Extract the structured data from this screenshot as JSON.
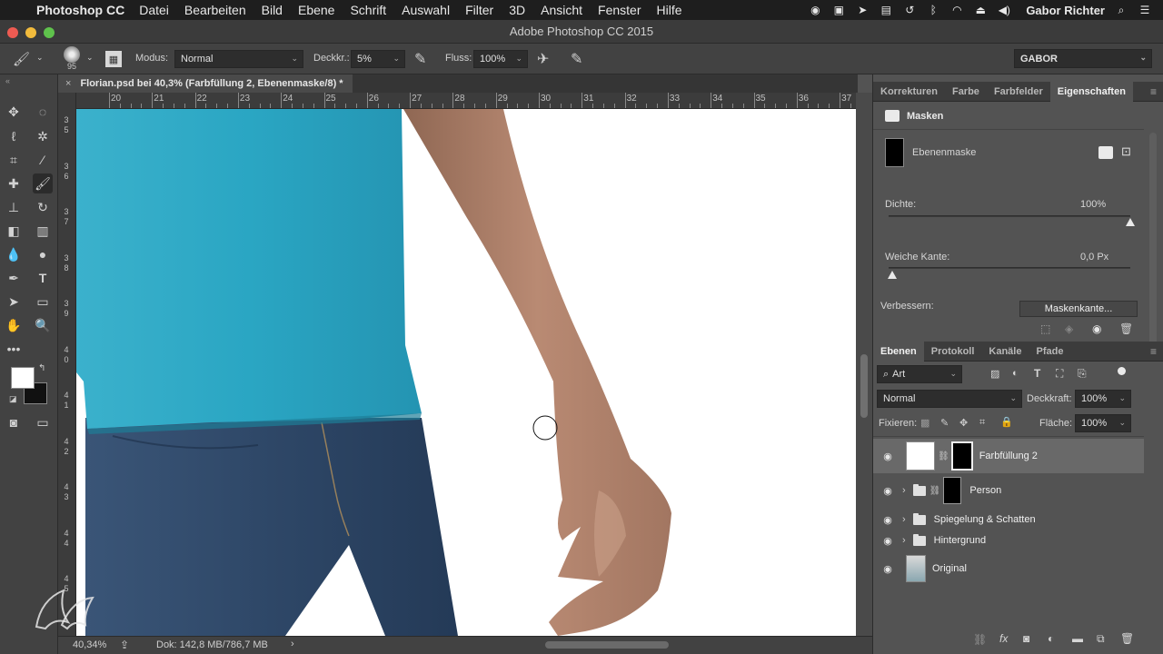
{
  "menubar": {
    "app_name": "Photoshop CC",
    "menus": [
      "Datei",
      "Bearbeiten",
      "Bild",
      "Ebene",
      "Schrift",
      "Auswahl",
      "Filter",
      "3D",
      "Ansicht",
      "Fenster",
      "Hilfe"
    ],
    "user_name": "Gabor Richter"
  },
  "window": {
    "title": "Adobe Photoshop CC 2015"
  },
  "options_bar": {
    "brush_size": "95",
    "modus_label": "Modus:",
    "modus_value": "Normal",
    "deckkraft_label": "Deckkr.:",
    "deckkraft_value": "5%",
    "fluss_label": "Fluss:",
    "fluss_value": "100%",
    "workspace": "GABOR"
  },
  "document": {
    "tab_title": "Florian.psd bei 40,3% (Farbfüllung 2, Ebenenmaske/8) *",
    "ruler_h": [
      "20",
      "21",
      "22",
      "23",
      "24",
      "25",
      "26",
      "27",
      "28",
      "29",
      "30",
      "31",
      "32",
      "33",
      "34",
      "35",
      "36",
      "37"
    ],
    "ruler_v": [
      "3",
      "5",
      "3",
      "6",
      "3",
      "7",
      "3",
      "8",
      "3",
      "9",
      "4",
      "0",
      "4",
      "1",
      "4",
      "2",
      "4",
      "3",
      "4",
      "4",
      "4",
      "5"
    ]
  },
  "status_bar": {
    "zoom": "40,34%",
    "doc_info": "Dok: 142,8 MB/786,7 MB"
  },
  "properties_panel": {
    "tabs": [
      "Korrekturen",
      "Farbe",
      "Farbfelder",
      "Eigenschaften"
    ],
    "active_tab": "Eigenschaften",
    "header": "Masken",
    "mask_label": "Ebenenmaske",
    "dichte_label": "Dichte:",
    "dichte_value": "100%",
    "dichte_level": 1.0,
    "weiche_kante_label": "Weiche Kante:",
    "weiche_kante_value": "0,0 Px",
    "weiche_kante_level": 0.0,
    "verbessern_label": "Verbessern:",
    "maskenkante_button": "Maskenkante..."
  },
  "layers_panel": {
    "tabs": [
      "Ebenen",
      "Protokoll",
      "Kanäle",
      "Pfade"
    ],
    "active_tab": "Ebenen",
    "filter_value": "Art",
    "blend_mode": "Normal",
    "deckkraft_label": "Deckkraft:",
    "deckkraft_value": "100%",
    "fixieren_label": "Fixieren:",
    "flaeche_label": "Fläche:",
    "flaeche_value": "100%",
    "layers": [
      {
        "name": "Farbfüllung 2",
        "selected": true
      },
      {
        "name": "Person",
        "selected": false
      },
      {
        "name": "Spiegelung & Schatten",
        "selected": false
      },
      {
        "name": "Hintergrund",
        "selected": false
      },
      {
        "name": "Original",
        "selected": false
      }
    ]
  },
  "colors": {
    "shirt": "#2aa7c4",
    "jeans": "#2c4463",
    "skin": "#b98a73",
    "panel_bg": "#535353",
    "selected_layer": "#696969"
  }
}
